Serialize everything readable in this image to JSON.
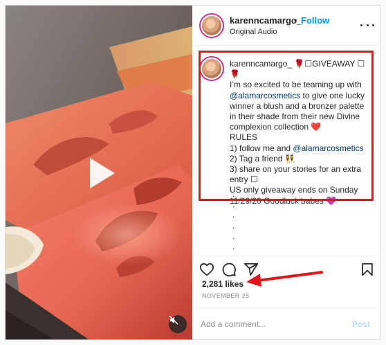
{
  "post": {
    "username": "karenncamargo_",
    "follow_separator": "•",
    "follow_label": "Follow",
    "subtitle": "Original Audio",
    "caption": {
      "author": "karenncamargo_",
      "line1_suffix": " 🌹☐GIVEAWAY ☐🌹",
      "line2": "I’m so excited to be teaming up with",
      "mention": "@alamarcosmetics",
      "line3_suffix": " to give one lucky winner a blush and a bronzer palette in their shade from their new Divine complexion collection ❤️",
      "rules_title": "RULES",
      "rule1_prefix": "1) follow me and ",
      "rule1_mention": "@alamarcosmetics",
      "rule2": "2) Tag a friend 👯‍♀️",
      "rule3": "3) share on your stories for an extra entry ☐",
      "footer": "US only giveaway ends on Sunday 11/29/20 Goodluck babes 💜",
      "dots": ".\n.\n.\n.\n.\n.\n."
    },
    "likes": "2,281 likes",
    "date": "NOVEMBER 25",
    "comment": {
      "placeholder": "Add a comment...",
      "value": "",
      "post_label": "Post"
    }
  },
  "icons": {
    "heart": "heart-icon",
    "comment": "comment-icon",
    "share": "paper-plane-icon",
    "save": "bookmark-icon",
    "play": "play-icon",
    "mute": "speaker-muted-icon",
    "more": "ellipsis-icon"
  },
  "colors": {
    "link_blue": "#0095f6",
    "mention_blue": "#00376b",
    "annotation_red": "#e0161c",
    "post_disabled": "#b2dffc"
  }
}
